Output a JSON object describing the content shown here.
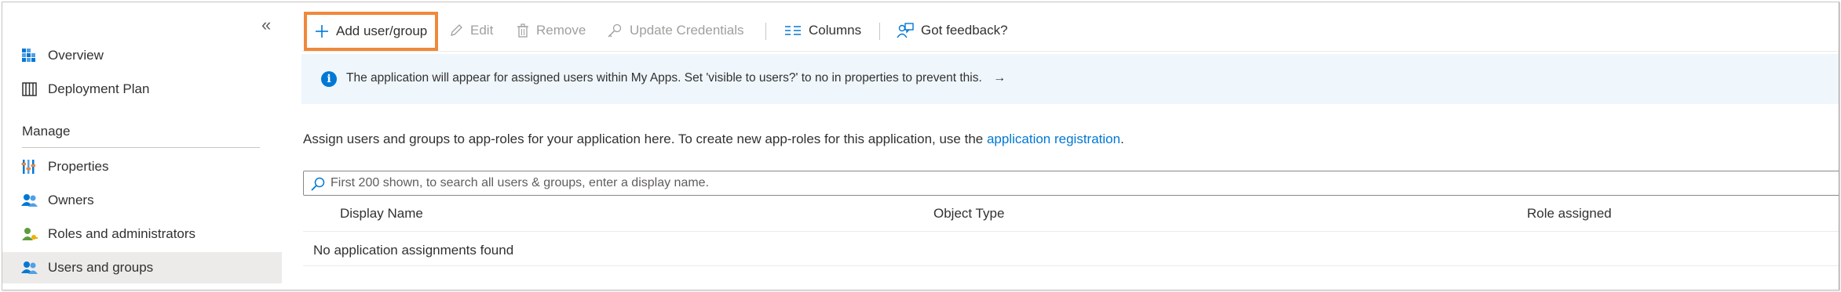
{
  "sidebar": {
    "collapse_glyph": "«",
    "items": [
      {
        "label": "Overview",
        "icon": "overview-icon"
      },
      {
        "label": "Deployment Plan",
        "icon": "book-icon"
      }
    ],
    "section": "Manage",
    "manage_items": [
      {
        "label": "Properties",
        "icon": "properties-icon"
      },
      {
        "label": "Owners",
        "icon": "owners-icon"
      },
      {
        "label": "Roles and administrators",
        "icon": "roles-icon"
      },
      {
        "label": "Users and groups",
        "icon": "users-groups-icon",
        "selected": true
      }
    ]
  },
  "toolbar": {
    "add": "Add user/group",
    "edit": "Edit",
    "remove": "Remove",
    "update_credentials": "Update Credentials",
    "columns": "Columns",
    "feedback": "Got feedback?"
  },
  "info": {
    "text": "The application will appear for assigned users within My Apps. Set 'visible to users?' to no in properties to prevent this.",
    "arrow": "→"
  },
  "assign": {
    "text": "Assign users and groups to app-roles for your application here. To create new app-roles for this application, use the ",
    "link": "application registration",
    "suffix": "."
  },
  "search": {
    "placeholder": "First 200 shown, to search all users & groups, enter a display name."
  },
  "table": {
    "columns": [
      "Display Name",
      "Object Type",
      "Role assigned"
    ],
    "empty_message": "No application assignments found"
  },
  "colors": {
    "accent": "#0078d4",
    "highlight_border": "#f0883a",
    "info_background": "#eff6fc",
    "selected_background": "#edebe9"
  }
}
